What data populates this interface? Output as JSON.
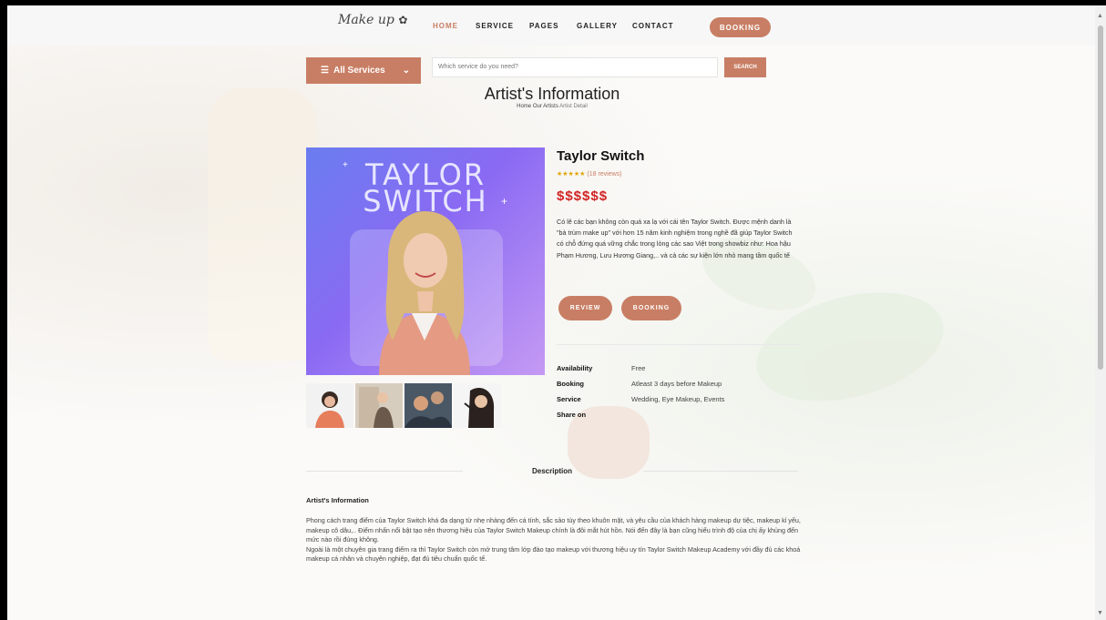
{
  "nav": {
    "logo": "Make up",
    "logo_flower": "✿",
    "items": [
      "HOME",
      "SERVICE",
      "PAGES",
      "GALLERY",
      "CONTACT"
    ],
    "booking": "BOOKING"
  },
  "search": {
    "category": "All Services",
    "placeholder": "Which service do you need?",
    "button": "SEARCH"
  },
  "page": {
    "title": "Artist's Information",
    "breadcrumb_home": "Home",
    "breadcrumb_artists": "Our Artists",
    "breadcrumb_current": "Artist Detail"
  },
  "hero": {
    "line1": "TAYLOR",
    "line2": "SWITCH"
  },
  "artist": {
    "name": "Taylor Switch",
    "stars": "★★★★★",
    "reviews": "(18 reviews)",
    "price": "$$$$$$",
    "description": "Có lẽ các bạn không còn quá xa lạ với cái tên Taylor Switch. Được mệnh danh là \"bà trùm make up\" với hơn 15 năm kinh nghiệm trong nghề đã giúp Taylor Switch có chỗ đứng quá vững chắc trong lòng các sao Việt trong showbiz như: Hoa hậu Phạm Hương, Lưu Hương Giang,.. và cả các sự kiện lớn nhỏ mang tầm quốc tế",
    "review_btn": "REVIEW",
    "booking_btn": "BOOKING"
  },
  "meta": {
    "availability_label": "Availability",
    "availability_value": "Free",
    "booking_label": "Booking",
    "booking_value": "Atleast 3 days before Makeup",
    "service_label": "Service",
    "service_value": "Wedding, Eye Makeup, Events",
    "share_label": "Share on"
  },
  "description_section": {
    "heading": "Description",
    "title": "Artist's Information",
    "para1": "Phong cách trang điểm của Taylor Switch khá đa dạng từ nhẹ nhàng đến cá tính, sắc sảo tùy theo khuôn mặt, và yêu cầu của khách hàng makeup dự tiệc, makeup kỉ yếu, makeup cô dâu,.. Điểm nhấn nổi bật tạo nên thương hiệu của Taylor Switch Makeup chính là đôi mắt hút hồn. Nói đến đây là bạn cũng hiểu trình độ của chị ấy khủng đến mức nào rồi đúng không.",
    "para2": "Ngoài là một chuyên gia trang điểm ra thì Taylor Switch còn mở trung tâm lớp đào tạo makeup với thương hiệu uy tín Taylor Switch Makeup Academy với đầy đủ các khoá makeup cá nhân và chuyên nghiệp, đạt đủ tiêu chuẩn quốc tế."
  },
  "colors": {
    "accent": "#c87e64",
    "price": "#d02424",
    "star": "#e0a400"
  }
}
